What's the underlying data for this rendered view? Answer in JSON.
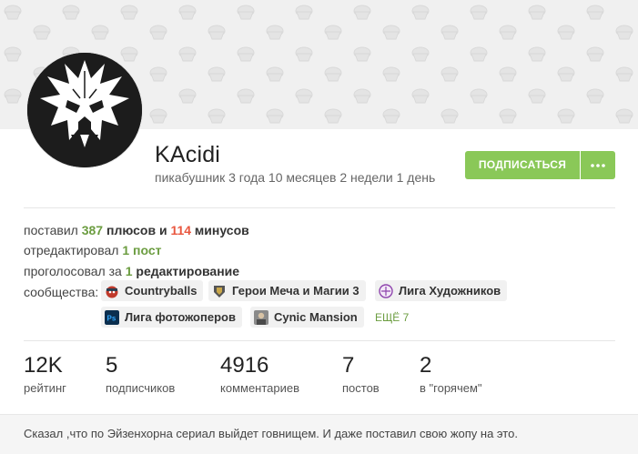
{
  "profile": {
    "username": "KAcidi",
    "tenure": "пикабушник 3 года 10 месяцев 2 недели 1 день",
    "subscribe_label": "ПОДПИСАТЬСЯ",
    "more_icon": "dots-icon"
  },
  "activity": {
    "line1_pre": "поставил",
    "pluses": "387",
    "line1_mid": "плюсов и",
    "minuses": "114",
    "line1_post": "минусов",
    "line2_pre": "отредактировал",
    "edits": "1 пост",
    "line3_pre": "проголосовал за",
    "votes_num": "1",
    "votes_word": "редактирование",
    "communities_label": "сообщества:"
  },
  "communities": [
    {
      "name": "Countryballs",
      "icon": "countryball-icon",
      "color": "#c0392b"
    },
    {
      "name": "Герои Меча и Магии 3",
      "icon": "heroes-icon",
      "color": "#555555"
    },
    {
      "name": "Лига Художников",
      "icon": "artist-league-icon",
      "color": "#8e44ad"
    },
    {
      "name": "Лига фотожоперов",
      "icon": "photoshop-icon",
      "color": "#0b2f4f"
    },
    {
      "name": "Cynic Mansion",
      "icon": "cynic-mansion-icon",
      "color": "#777777"
    }
  ],
  "communities_more": "ЕЩЁ 7",
  "metrics": [
    {
      "value": "12K",
      "label": "рейтинг"
    },
    {
      "value": "5",
      "label": "подписчиков"
    },
    {
      "value": "4916",
      "label": "комментариев"
    },
    {
      "value": "7",
      "label": "постов"
    },
    {
      "value": "2",
      "label": "в \"горячем\""
    }
  ],
  "note": "Сказал ,что по Эйзенхорна сериал выйдет говнищем. И даже поставил свою жопу на это.",
  "colors": {
    "accent": "#8ac858",
    "plus": "#6c9d41",
    "minus": "#e9573f"
  }
}
